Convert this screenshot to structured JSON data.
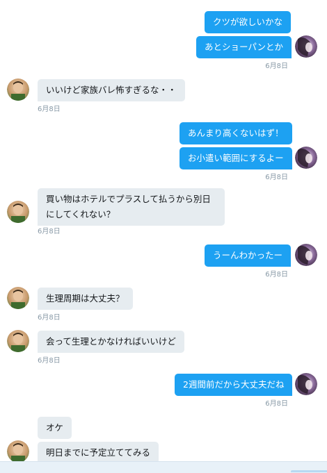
{
  "conversation": {
    "messages": [
      {
        "text": "クツが欲しいかな",
        "time": ""
      },
      {
        "text": "あとショーパンとか",
        "time": "6月8日"
      },
      {
        "text": "いいけど家族バレ怖すぎるな・・",
        "time": "6月8日"
      },
      {
        "text": "あんまり高くないはず！",
        "time": ""
      },
      {
        "text": "お小遣い範囲にするよー",
        "time": "6月8日"
      },
      {
        "text": "買い物はホテルでプラスして払うから別日にしてくれない？",
        "time": "6月8日"
      },
      {
        "text": "うーんわかったー",
        "time": "6月8日"
      },
      {
        "text": "生理周期は大丈夫？",
        "time": "6月8日"
      },
      {
        "text": "会って生理とかなければいいけど",
        "time": "6月8日"
      },
      {
        "text": "2週間前だから大丈夫だね",
        "time": "6月8日"
      },
      {
        "text": "オケ",
        "time": ""
      },
      {
        "text": "明日までに予定立ててみる",
        "time": ""
      }
    ]
  },
  "colors": {
    "outgoing_bubble": "#1da1f2",
    "incoming_bubble": "#e6ecf0",
    "timestamp": "#8899a6"
  },
  "icons": {
    "me_avatar": "user-avatar-icon",
    "other_avatar": "contact-avatar-icon"
  }
}
